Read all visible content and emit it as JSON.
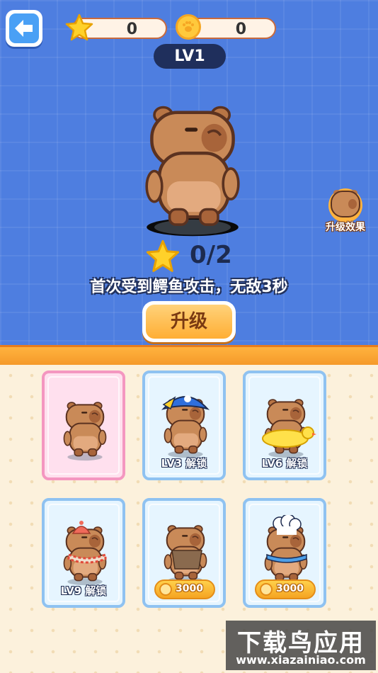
{
  "header": {
    "star_count": "0",
    "coin_count": "0",
    "level_badge": "LV1"
  },
  "character": {
    "progress": "0/2",
    "description": "首次受到鳄鱼攻击，无敌3秒",
    "upgrade_label": "升级",
    "effect_label": "升级效果"
  },
  "skins": [
    {
      "status": ""
    },
    {
      "status": "LV3 解锁"
    },
    {
      "status": "LV6 解锁"
    },
    {
      "status": "LV9 解锁"
    },
    {
      "price": "3000"
    },
    {
      "price": "3000"
    }
  ],
  "watermark": {
    "title": "下载鸟应用",
    "url": "www.xiazainiao.com"
  },
  "colors": {
    "background_blue": "#4e7ee0",
    "accent_orange": "#ffae34",
    "selected_pink": "#f497c0",
    "card_blue": "#8fc2f1"
  }
}
